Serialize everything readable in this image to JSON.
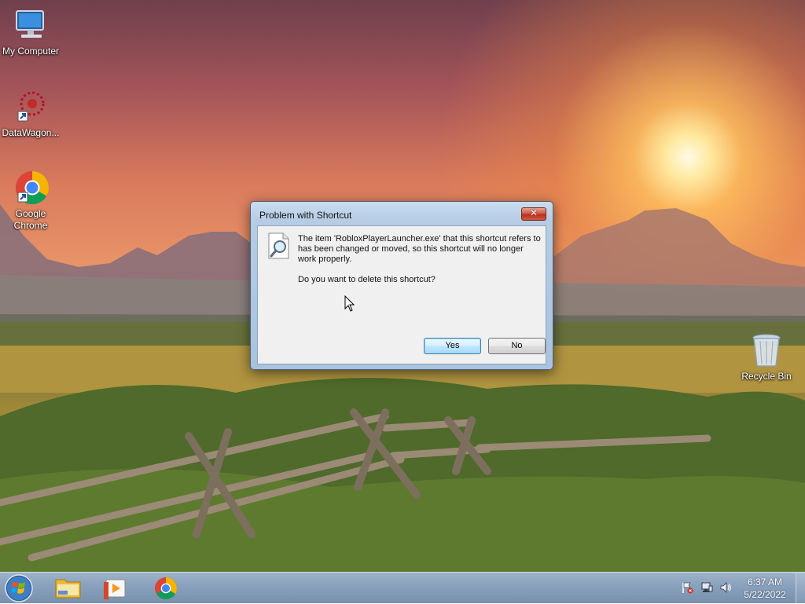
{
  "desktop": {
    "icons": [
      {
        "label": "My Computer"
      },
      {
        "label": "DataWagon..."
      },
      {
        "label": "Google Chrome"
      },
      {
        "label": "Recycle Bin"
      }
    ]
  },
  "dialog": {
    "title": "Problem with Shortcut",
    "close_label": "✕",
    "message": "The item 'RobloxPlayerLauncher.exe' that this shortcut refers to has been changed or moved, so this shortcut will no longer work properly.",
    "question": "Do you want to delete this shortcut?",
    "yes_label": "Yes",
    "no_label": "No"
  },
  "taskbar": {
    "pinned": [
      "start-orb",
      "file-explorer-icon",
      "media-player-icon",
      "chrome-icon"
    ],
    "tray_icons": [
      "action-center-flag-icon",
      "network-icon",
      "volume-icon"
    ],
    "time": "6:37 AM",
    "date": "5/22/2022"
  },
  "colors": {
    "taskbar": "#8aa2bd",
    "dialog_frame": "#b5cce4",
    "default_button": "#3c7fb1"
  }
}
